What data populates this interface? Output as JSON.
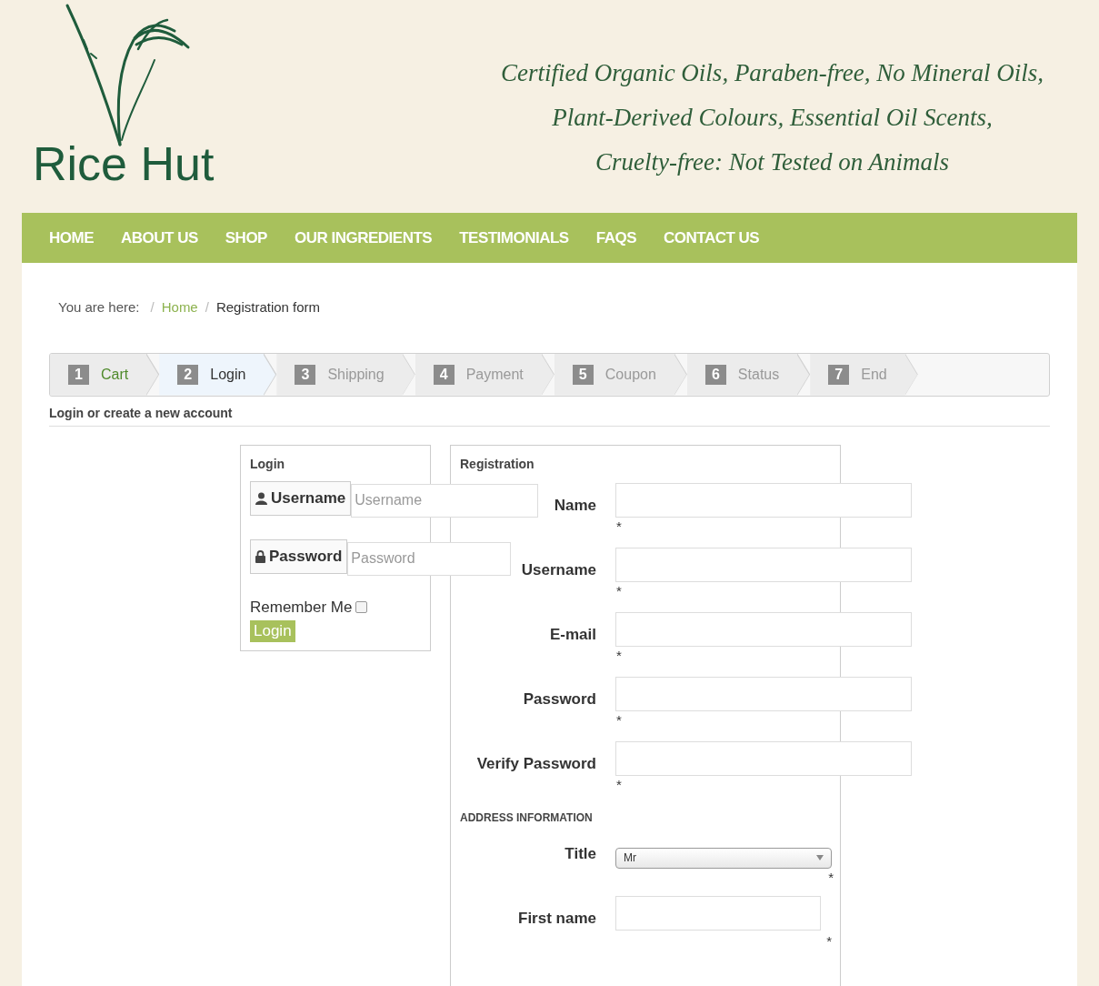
{
  "brand": {
    "name": "Rice Hut"
  },
  "tagline": [
    "Certified Organic Oils, Paraben-free, No Mineral Oils,",
    "Plant-Derived Colours, Essential Oil Scents,",
    "Cruelty-free: Not Tested on Animals"
  ],
  "nav": [
    "HOME",
    "ABOUT US",
    "SHOP",
    "OUR INGREDIENTS",
    "TESTIMONIALS",
    "FAQS",
    "CONTACT US"
  ],
  "breadcrumb": {
    "label": "You are here:",
    "items": [
      {
        "separator": "/",
        "text": "Home",
        "kind": "link"
      },
      {
        "separator": "/",
        "text": "Registration form",
        "kind": "current"
      }
    ]
  },
  "steps": [
    {
      "number": "1",
      "label": "Cart",
      "kind": "done",
      "selected": false
    },
    {
      "number": "2",
      "label": "Login",
      "kind": "current",
      "selected": true
    },
    {
      "number": "3",
      "label": "Shipping",
      "kind": "todo",
      "selected": false
    },
    {
      "number": "4",
      "label": "Payment",
      "kind": "todo",
      "selected": false
    },
    {
      "number": "5",
      "label": "Coupon",
      "kind": "todo",
      "selected": false
    },
    {
      "number": "6",
      "label": "Status",
      "kind": "todo",
      "selected": false
    },
    {
      "number": "7",
      "label": "End",
      "kind": "todo",
      "selected": false
    }
  ],
  "section_title": "Login or create a new account",
  "login": {
    "title": "Login",
    "username": {
      "label": "Username",
      "placeholder": "Username"
    },
    "password": {
      "label": "Password",
      "placeholder": "Password"
    },
    "remember": {
      "label": "Remember Me",
      "checked": false
    },
    "button": "Login"
  },
  "registration": {
    "title": "Registration",
    "fields": [
      {
        "label": "Name",
        "required": "*"
      },
      {
        "label": "Username",
        "required": "*"
      },
      {
        "label": "E-mail",
        "required": "*"
      },
      {
        "label": "Password",
        "required": "*"
      },
      {
        "label": "Verify Password",
        "required": "*"
      }
    ],
    "address_title": "ADDRESS INFORMATION",
    "address_fields": [
      {
        "label": "Title",
        "kind": "select",
        "value": "Mr",
        "required": "*"
      },
      {
        "label": "First name",
        "kind": "short",
        "required": "*"
      }
    ]
  }
}
